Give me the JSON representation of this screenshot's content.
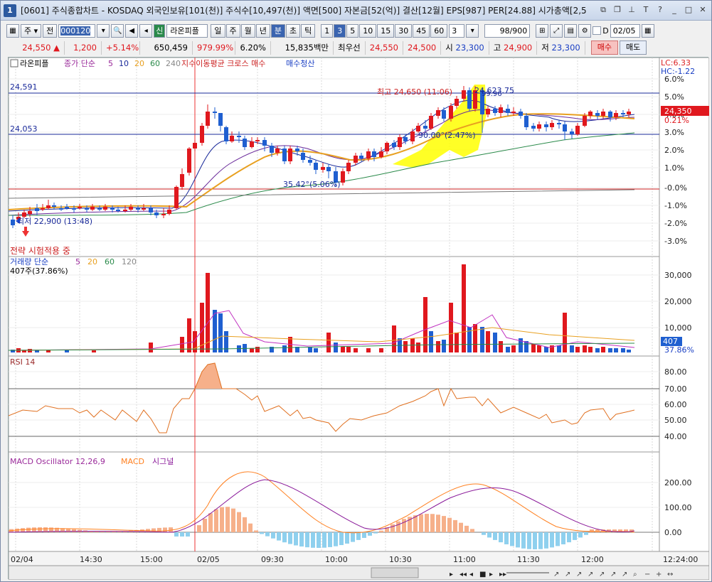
{
  "window": {
    "number": "1",
    "title": "[0601] 주식종합차트 - KOSDAQ 외국인보유[101(천)] 주식수[10,497(천)] 액면[500] 자본금[52(억)] 결산[12월] EPS[987] PER[24.88] 시가총액[2,5",
    "icons": [
      "pin-icon",
      "restore-icon",
      "save-icon",
      "T",
      "?",
      "_",
      "□",
      "X"
    ]
  },
  "toolbar": {
    "type_select": "주",
    "prev_label": "전",
    "code_value": "000120",
    "stock_badge": "신",
    "stock_name": "라온피플",
    "periods": [
      "일",
      "주",
      "월",
      "년",
      "분",
      "초",
      "틱"
    ],
    "selected_period": "분",
    "intervals": [
      "1",
      "3",
      "5",
      "10",
      "15",
      "30",
      "45",
      "60"
    ],
    "selected_interval": "3",
    "interval_value": "3",
    "count_value": "98",
    "count_total": "/900",
    "d_label": "D",
    "date_value": "02/05"
  },
  "quote": {
    "price": "24,550",
    "arrow": "▲",
    "change": "1,200",
    "change_pct": "+5.14%",
    "volume": "650,459",
    "volume_pct": "979.99%",
    "turnover_pct": "6.20%",
    "amount": "15,835백만",
    "best_ask_label": "최우선",
    "best_ask": "24,550",
    "best_bid": "24,500",
    "open_label": "시",
    "open": "23,300",
    "high_label": "고",
    "high": "24,900",
    "low_label": "저",
    "low": "23,300",
    "buy_label": "매수",
    "sell_label": "매도"
  },
  "price_panel": {
    "legend_name": "라온피플",
    "legend_ma": "종가 단순",
    "legend_periods": [
      "5",
      "10",
      "20",
      "60",
      "240"
    ],
    "legend_signal": "지수이동평균 크로스 매수",
    "legend_exit": "매수청산",
    "lc": "LC:6.33",
    "hc": "HC:-1.22",
    "hline1": "24,591",
    "hline2": "24,053",
    "high_annot": "최고 24,650 (11:06)",
    "high_val": "24,623.75",
    "high_val2": "99.96",
    "low_annot": "최저 22,900 (13:48)",
    "mid_annot": "35.42°(5.06%)",
    "mid_annot2": "90.00°(2.47%)",
    "strategy": "전략 시험적용 중",
    "current_price": "24,350",
    "current_pct": "0.21%",
    "y_ticks": [
      "6.0%",
      "5.0%",
      "4.0%",
      "3.0%",
      "2.0%",
      "1.0%",
      "-0.0%",
      "-1.0%",
      "-2.0%",
      "-3.0%"
    ]
  },
  "volume_panel": {
    "legend": "거래량 단순",
    "legend_periods": [
      "5",
      "20",
      "60",
      "120"
    ],
    "sub": "407주(37.86%)",
    "y_ticks": [
      "30,000",
      "20,000",
      "10,000"
    ],
    "current": "407",
    "current_pct": "37.86%"
  },
  "rsi_panel": {
    "legend": "RSI 14",
    "y_ticks": [
      "80.00",
      "70.00",
      "60.00",
      "50.00",
      "40.00"
    ]
  },
  "macd_panel": {
    "legend_osc": "MACD Oscillator 12,26,9",
    "legend_macd": "MACD",
    "legend_signal": "시그널",
    "y_ticks": [
      "200.00",
      "100.00",
      "0.00"
    ]
  },
  "x_axis": {
    "labels": [
      "02/04",
      "14:30",
      "15:00",
      "02/05",
      "09:30",
      "10:00",
      "10:30",
      "11:00",
      "11:30",
      "12:00"
    ],
    "time_now": "12:24:00"
  },
  "colors": {
    "up": "#e0181e",
    "down": "#1f5fd0",
    "ma5": "#1a2a9a",
    "ma20": "#e8a020",
    "ma60": "#2a8a4a",
    "ma240": "#8a2a2a",
    "rsi": "#e07020",
    "macd": "#ff8020",
    "signal": "#8a1a9a",
    "osc_pos": "#f6b08a",
    "osc_neg": "#8fd0ee"
  }
}
